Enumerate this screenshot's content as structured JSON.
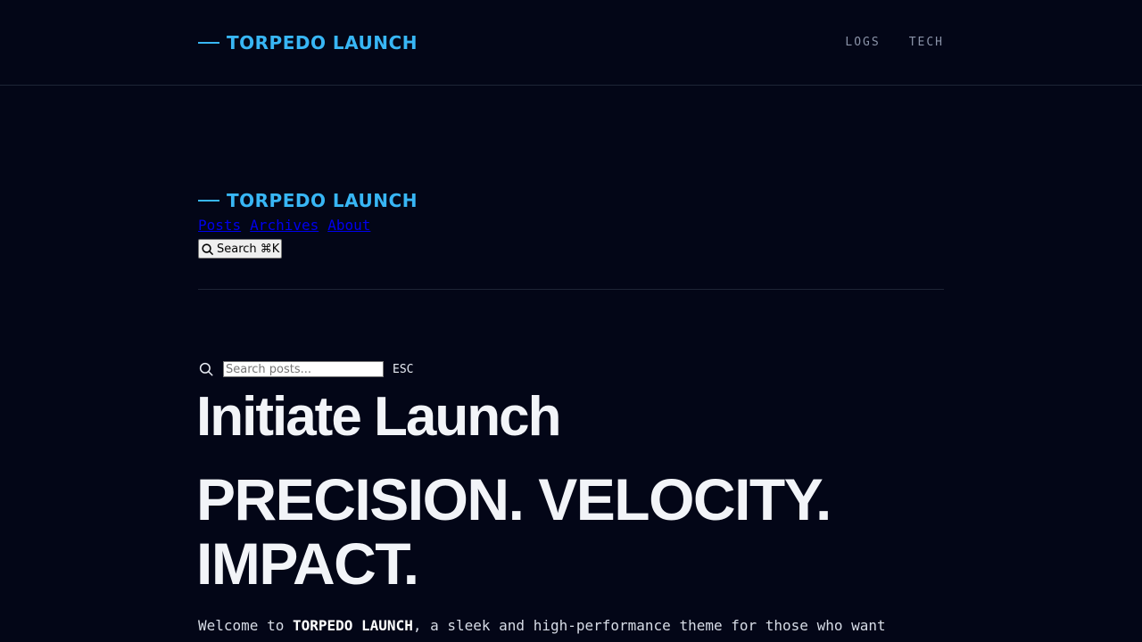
{
  "header": {
    "brand": "TORPEDO LAUNCH",
    "nav": [
      "LOGS",
      "TECH"
    ]
  },
  "site": {
    "brand": "TORPEDO LAUNCH",
    "nav": [
      "Posts",
      "Archives",
      "About"
    ],
    "search_button": "Search ⌘K"
  },
  "search": {
    "placeholder": "Search posts...",
    "esc_label": "ESC"
  },
  "page": {
    "title": "Initiate Launch",
    "hero_line1": "PRECISION. VELOCITY.",
    "hero_line2": "IMPACT.",
    "intro_before": "Welcome to ",
    "intro_strong": "TORPEDO LAUNCH",
    "intro_after": ", a sleek and high-performance theme for those who want"
  },
  "colors": {
    "background": "#030617",
    "accent": "#38b6f5",
    "divider": "#1e2536"
  },
  "icons": [
    "search-icon"
  ]
}
